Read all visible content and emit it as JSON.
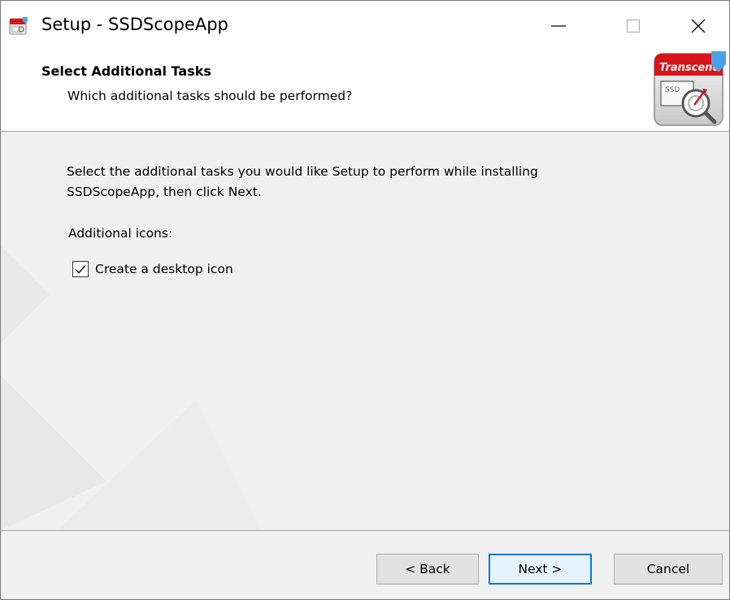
{
  "window": {
    "title": "Setup - SSDScopeApp",
    "controls": [
      "minimize-icon",
      "maximize-icon",
      "close-icon"
    ]
  },
  "header": {
    "title": "Select Additional Tasks",
    "subtitle": "Which additional tasks should be performed?",
    "logo_text": "Transcend",
    "logo_badge": "SSD"
  },
  "content": {
    "instruction_line1": "Select the additional tasks you would like Setup to perform while installing",
    "instruction_line2": "SSDScopeApp, then click Next.",
    "section_label": "Additional icons:",
    "tasks": [
      {
        "label": "Create a desktop icon",
        "checked": true
      }
    ]
  },
  "footer": {
    "back_label": "< Back",
    "next_label": "Next >",
    "cancel_label": "Cancel"
  },
  "colors": {
    "accent": "#0078d7",
    "logo_red": "#d7141a",
    "logo_arrow": "#4aa3e8"
  }
}
